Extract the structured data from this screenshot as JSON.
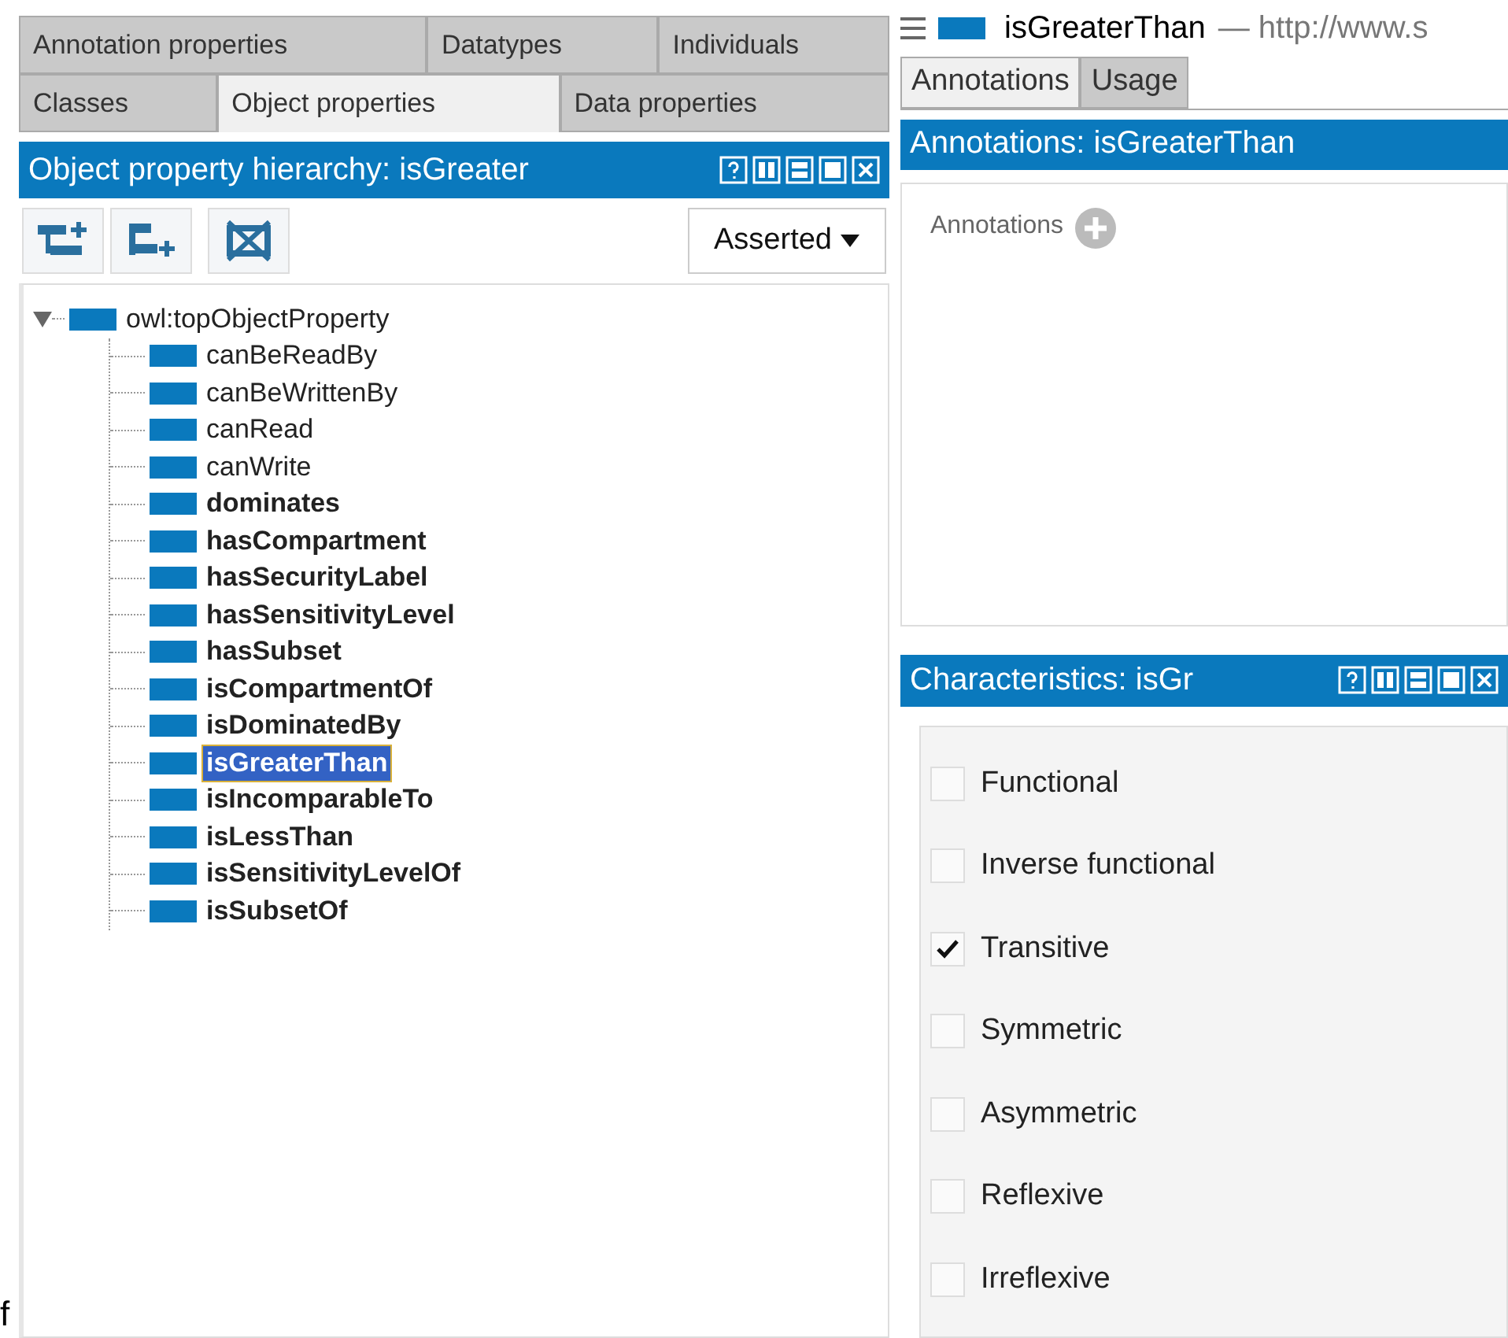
{
  "left_tabs": {
    "rows": [
      [
        {
          "label": "Annotation properties",
          "selected": false
        },
        {
          "label": "Datatypes",
          "selected": false
        },
        {
          "label": "Individuals",
          "selected": false
        }
      ],
      [
        {
          "label": "Classes",
          "selected": false
        },
        {
          "label": "Object properties",
          "selected": true
        },
        {
          "label": "Data properties",
          "selected": false
        }
      ]
    ]
  },
  "hierarchy": {
    "title": "Object property hierarchy: isGreater",
    "mode": "Asserted",
    "root": {
      "label": "owl:topObjectProperty",
      "expanded": true,
      "children": [
        {
          "label": "canBeReadBy",
          "bold": false,
          "selected": false
        },
        {
          "label": "canBeWrittenBy",
          "bold": false,
          "selected": false
        },
        {
          "label": "canRead",
          "bold": false,
          "selected": false
        },
        {
          "label": "canWrite",
          "bold": false,
          "selected": false
        },
        {
          "label": "dominates",
          "bold": true,
          "selected": false
        },
        {
          "label": "hasCompartment",
          "bold": true,
          "selected": false
        },
        {
          "label": "hasSecurityLabel",
          "bold": true,
          "selected": false
        },
        {
          "label": "hasSensitivityLevel",
          "bold": true,
          "selected": false
        },
        {
          "label": "hasSubset",
          "bold": true,
          "selected": false
        },
        {
          "label": "isCompartmentOf",
          "bold": true,
          "selected": false
        },
        {
          "label": "isDominatedBy",
          "bold": true,
          "selected": false
        },
        {
          "label": "isGreaterThan",
          "bold": true,
          "selected": true
        },
        {
          "label": "isIncomparableTo",
          "bold": true,
          "selected": false
        },
        {
          "label": "isLessThan",
          "bold": true,
          "selected": false
        },
        {
          "label": "isSensitivityLevelOf",
          "bold": true,
          "selected": false
        },
        {
          "label": "isSubsetOf",
          "bold": true,
          "selected": false
        }
      ]
    }
  },
  "stray_text": "f",
  "entity": {
    "name": "isGreaterThan",
    "iri": "— http://www.s"
  },
  "right_tabs": [
    {
      "label": "Annotations",
      "selected": true
    },
    {
      "label": "Usage",
      "selected": false
    }
  ],
  "annotations": {
    "title": "Annotations: isGreaterThan",
    "label": "Annotations"
  },
  "characteristics": {
    "title": "Characteristics: isGr",
    "items": [
      {
        "label": "Functional",
        "checked": false
      },
      {
        "label": "Inverse functional",
        "checked": false
      },
      {
        "label": "Transitive",
        "checked": true
      },
      {
        "label": "Symmetric",
        "checked": false
      },
      {
        "label": "Asymmetric",
        "checked": false
      },
      {
        "label": "Reflexive",
        "checked": false
      },
      {
        "label": "Irreflexive",
        "checked": false
      }
    ]
  }
}
